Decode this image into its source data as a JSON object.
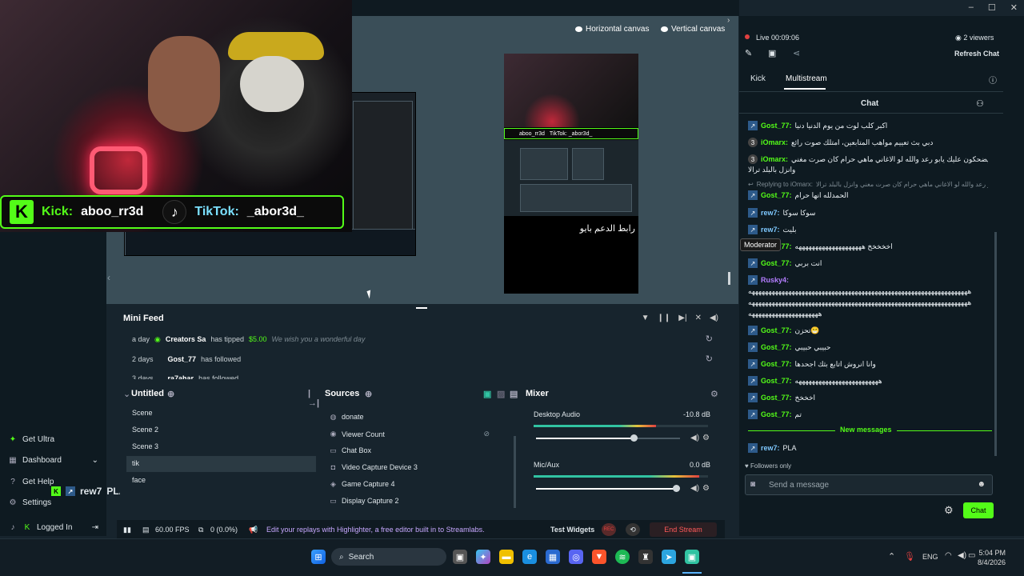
{
  "overlay": {
    "kick_label": "Kick:",
    "kick_user": "aboo_rr3d",
    "tiktok_label": "TikTok:",
    "tiktok_user": "_abor3d_"
  },
  "canvas": {
    "horizontal": "Horizontal canvas",
    "vertical": "Vertical canvas",
    "vertical_text": "رابط الدعم بايو",
    "stream_kick": "aboo_rr3d",
    "stream_tiktok": "TikTok: _abor3d_"
  },
  "sidebar": {
    "get_ultra": "Get Ultra",
    "dashboard": "Dashboard",
    "get_help": "Get Help",
    "settings": "Settings",
    "logged_in": "Logged In",
    "overlay_user": "rew7",
    "overlay_msg": "PLA"
  },
  "minifeed": {
    "title": "Mini Feed",
    "rows": [
      {
        "time": "a day",
        "user": "Creators Sa",
        "action": "has tipped",
        "amount": "$5.00",
        "note": "We wish you a wonderful day"
      },
      {
        "time": "2 days",
        "user": "Gost_77",
        "action": "has followed"
      },
      {
        "time": "3 days",
        "user": "ra7ahar",
        "action": "has followed"
      }
    ]
  },
  "scenes": {
    "title": "Untitled",
    "items": [
      "Scene",
      "Scene 2",
      "Scene 3",
      "tik",
      "face"
    ],
    "selected": "tik"
  },
  "sources": {
    "title": "Sources",
    "items": [
      {
        "label": "donate",
        "icon": "globe-icon"
      },
      {
        "label": "Viewer Count",
        "icon": "eye-icon"
      },
      {
        "label": "Chat Box",
        "icon": "chat-icon"
      },
      {
        "label": "Video Capture Device 3",
        "icon": "camera-icon"
      },
      {
        "label": "Game Capture 4",
        "icon": "gamepad-icon"
      },
      {
        "label": "Display Capture 2",
        "icon": "monitor-icon"
      }
    ]
  },
  "mixer": {
    "title": "Mixer",
    "channels": [
      {
        "name": "Desktop Audio",
        "value": "-10.8 dB",
        "level": 0.7
      },
      {
        "name": "Mic/Aux",
        "value": "0.0 dB",
        "level": 0.95
      }
    ]
  },
  "footer": {
    "fps": "60.00 FPS",
    "dropped": "0 (0.0%)",
    "promo": "Edit your replays with Highlighter, a free editor built in to Streamlabs.",
    "test_widgets": "Test Widgets",
    "rec": "REC",
    "end_stream": "End Stream"
  },
  "chat": {
    "live_label": "Live",
    "live_time": "00:09:06",
    "viewers": "2 viewers",
    "refresh": "Refresh Chat",
    "tab_kick": "Kick",
    "tab_multistream": "Multistream",
    "header": "Chat",
    "messages": [
      {
        "user": "Gost_77:",
        "text": "اكبر كلب لوت من يوم الدنيا دنيا",
        "badge": "kick",
        "color": "g"
      },
      {
        "user": "iOmarx:",
        "text": "دبي بث تعييم مواهب المتابعين، امتلك صوت رائع",
        "badge": "round",
        "color": "g"
      },
      {
        "user": "iOmarx:",
        "text": "لايضحكون عليك يابو رعد والله لو الاغاني ماهي حرام كان صرت مغني",
        "badge": "round",
        "color": "g"
      },
      {
        "user": "",
        "text": "وانزل بالبلد ترالا",
        "badge": "",
        "color": ""
      },
      {
        "user": "Replying to iOmarx:",
        "text": "يابو رعد والله لو الاغاني ماهي حرام كان صرت مغني وانزل بالبلد ترالا",
        "badge": "",
        "color": "reply"
      },
      {
        "user": "Gost_77:",
        "text": "الحمدلله انها حرام",
        "badge": "kick",
        "color": "g"
      },
      {
        "user": "rew7:",
        "text": "سوكا سوكا",
        "badge": "kick",
        "color": "b"
      },
      {
        "user": "rew7:",
        "text": "بليت",
        "badge": "kick",
        "color": "b"
      },
      {
        "user": "Gost_77:",
        "text": "اخخخخخ ههههههههههههههههههههه",
        "badge": "kick",
        "color": "g"
      },
      {
        "user": "Gost_77:",
        "text": "انت بربي",
        "badge": "kick",
        "color": "g"
      },
      {
        "user": "Rusky4:",
        "text": "",
        "badge": "kick",
        "color": "p"
      },
      {
        "user": "",
        "text": "ههههههههههههههههههههههههههههههههههههههههههههههههههههههههههههههههههه",
        "badge": "",
        "color": ""
      },
      {
        "user": "",
        "text": "ههههههههههههههههههههههههههههههههههههههههههههههههههههههههههههههههههه",
        "badge": "",
        "color": ""
      },
      {
        "user": "",
        "text": "هههههههههههههههههههههه",
        "badge": "",
        "color": ""
      },
      {
        "user": "Gost_77:",
        "text": "تحزن😁",
        "badge": "kick",
        "color": "g"
      },
      {
        "user": "Gost_77:",
        "text": "حبيبي حبيبي",
        "badge": "kick",
        "color": "g"
      },
      {
        "user": "Gost_77:",
        "text": "وانا انروش اتابع بثك اجحدها",
        "badge": "kick",
        "color": "g"
      },
      {
        "user": "Gost_77:",
        "text": "هههههههههههههههههههههههههه",
        "badge": "kick",
        "color": "g"
      },
      {
        "user": "Gost_77:",
        "text": "اخخخخ",
        "badge": "kick",
        "color": "g"
      },
      {
        "user": "Gost_77:",
        "text": "تم",
        "badge": "kick",
        "color": "g"
      }
    ],
    "new_messages": "New messages",
    "latest": {
      "user": "rew7:",
      "text": "PLA"
    },
    "followers_only": "Followers only",
    "input_placeholder": "Send a message",
    "send": "Chat",
    "tooltip": "Moderator"
  },
  "taskbar": {
    "search": "Search",
    "lang": "ENG",
    "time": "5:04 PM",
    "date": "8/4/2026"
  }
}
